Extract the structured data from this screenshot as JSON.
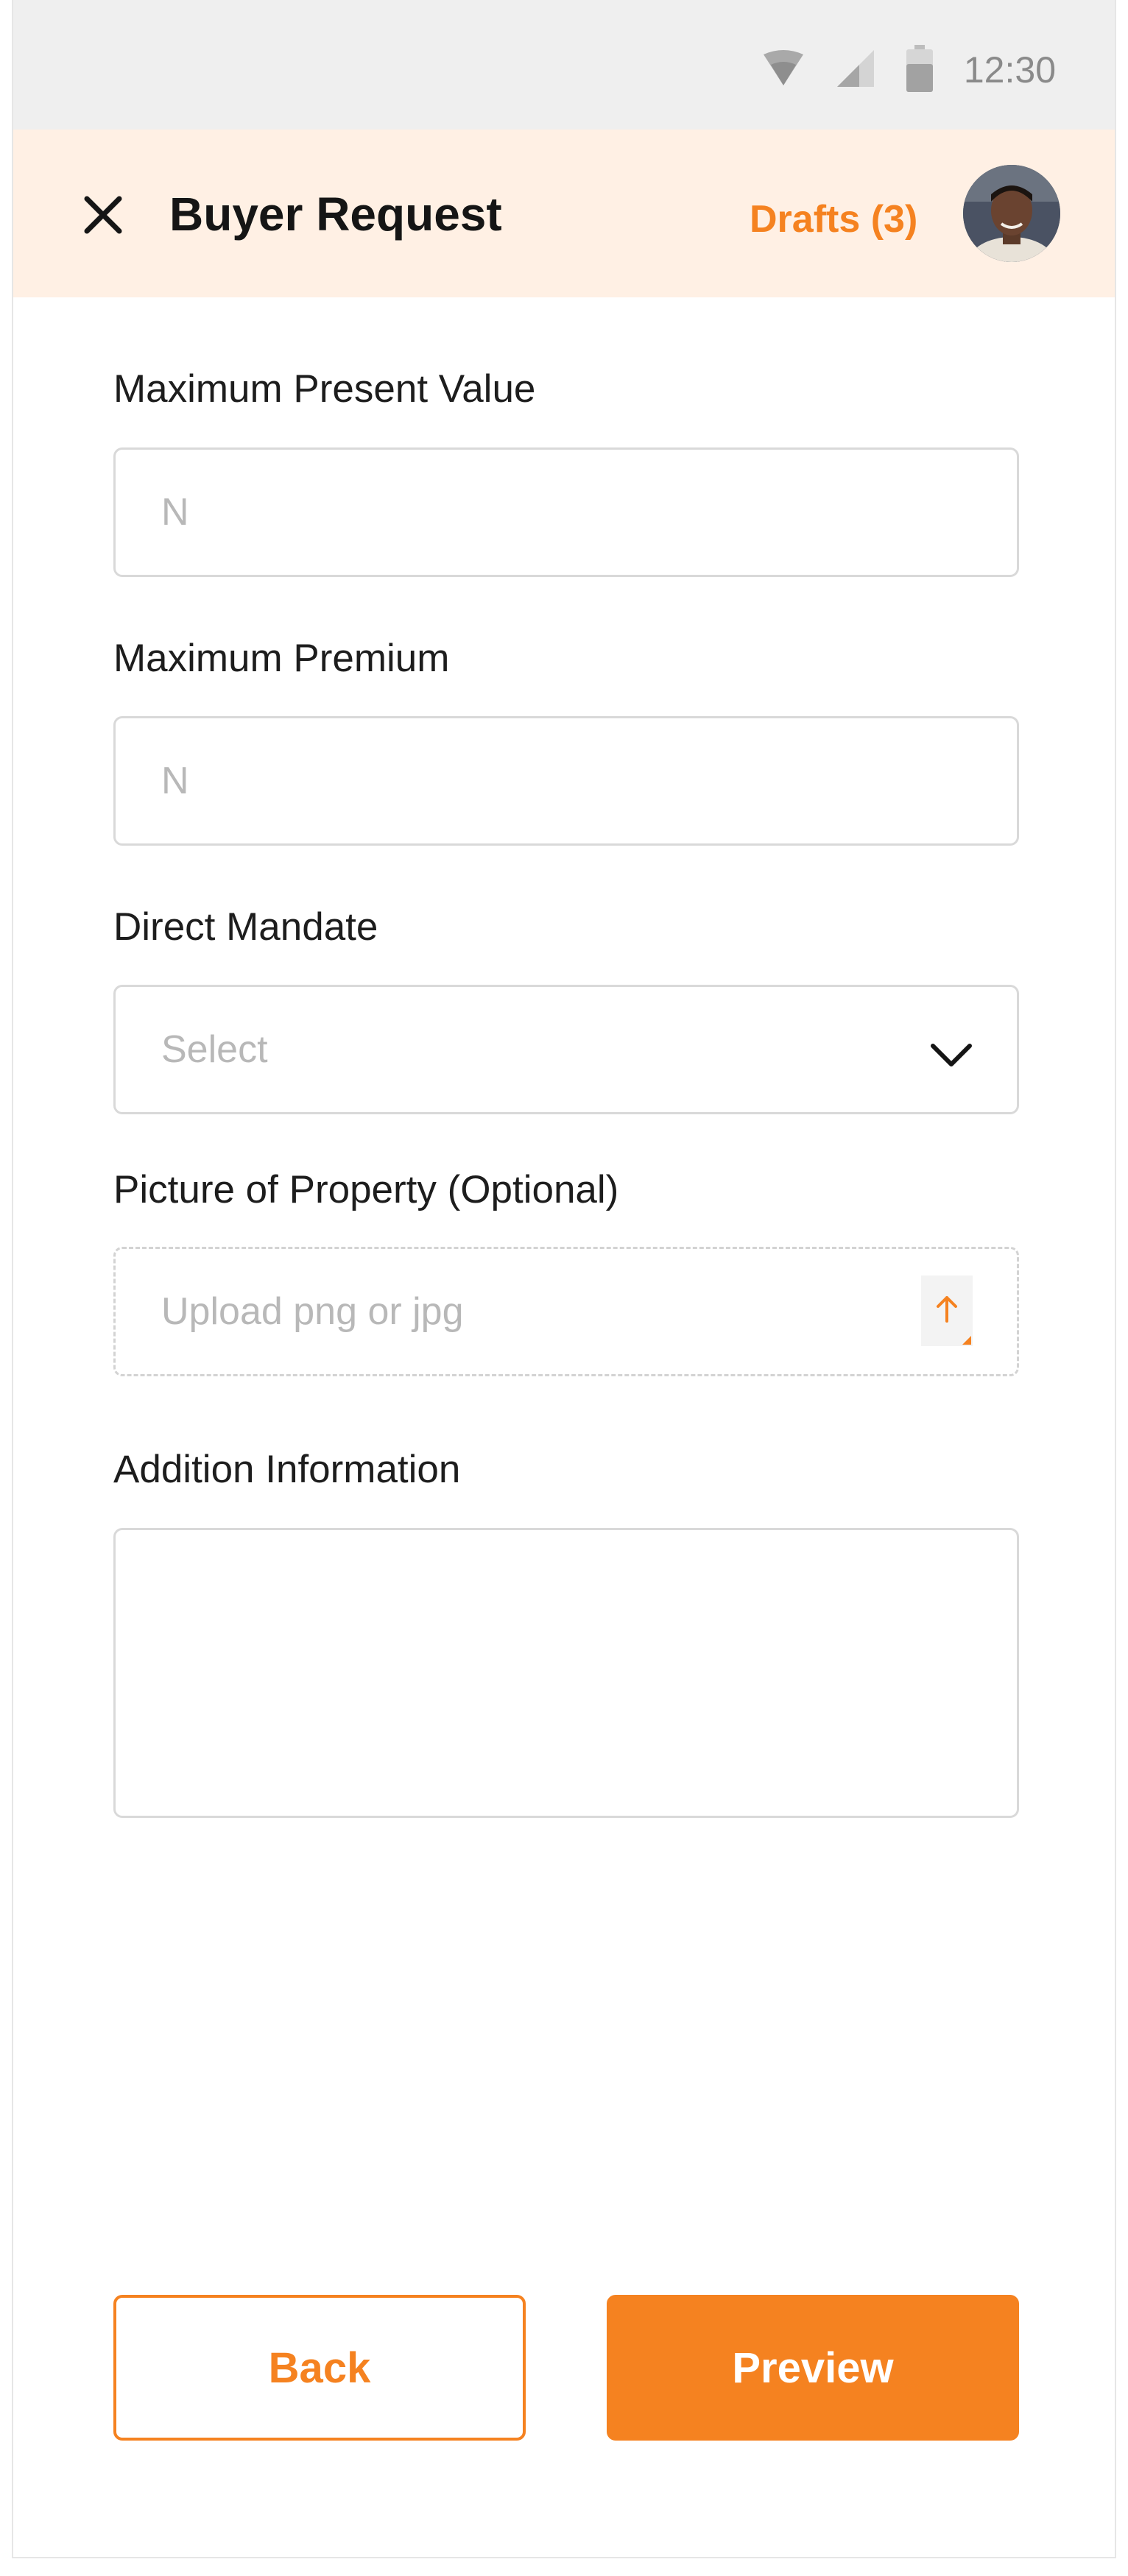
{
  "status_bar": {
    "time": "12:30",
    "icons": [
      "wifi-icon",
      "signal-icon",
      "battery-icon"
    ]
  },
  "header": {
    "title": "Buyer Request",
    "drafts_label": "Drafts (3)",
    "close_icon": "close-icon",
    "avatar": "user-avatar"
  },
  "form": {
    "max_present_value": {
      "label": "Maximum Present Value",
      "placeholder": "N",
      "value": ""
    },
    "max_premium": {
      "label": "Maximum Premium",
      "placeholder": "N",
      "value": ""
    },
    "direct_mandate": {
      "label": "Direct Mandate",
      "placeholder": "Select",
      "icon": "chevron-down-icon"
    },
    "picture": {
      "label": "Picture of Property (Optional)",
      "placeholder": "Upload png or jpg",
      "icon": "upload-icon"
    },
    "addition_info": {
      "label": "Addition Information",
      "value": ""
    }
  },
  "actions": {
    "back_label": "Back",
    "preview_label": "Preview"
  },
  "colors": {
    "accent": "#f58220",
    "header_bg": "#fff0e4",
    "status_bg": "#efefef",
    "border": "#d9d9d9",
    "placeholder": "#b8b8b8"
  }
}
